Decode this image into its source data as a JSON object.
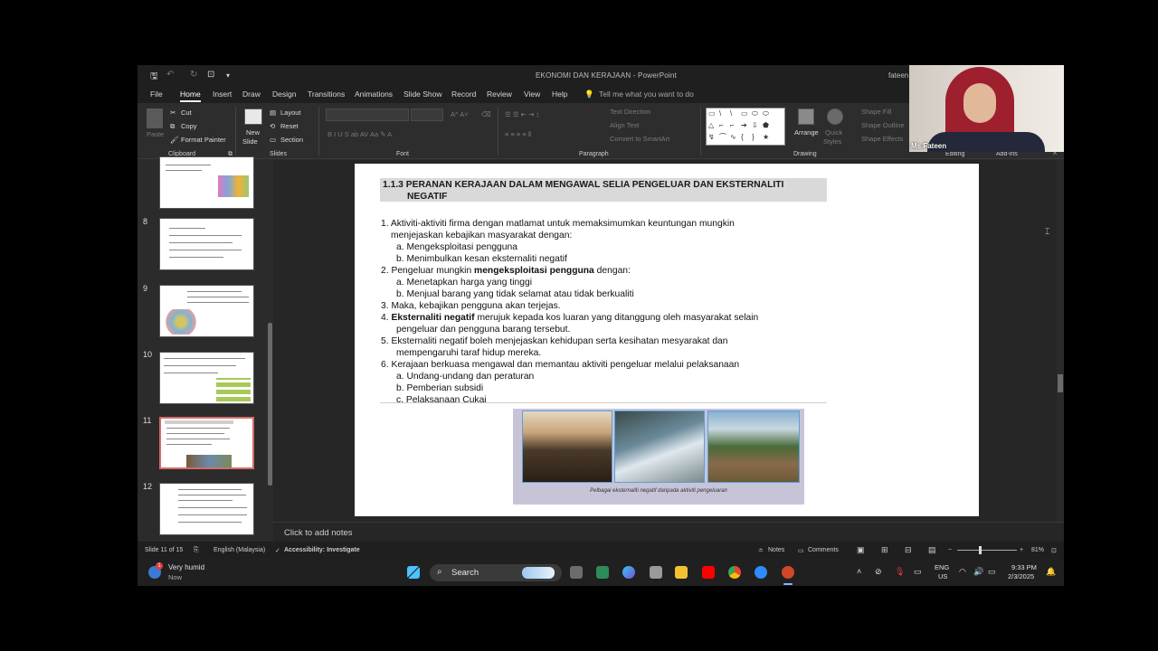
{
  "titlebar": {
    "title": "EKONOMI DAN KERAJAAN  -  PowerPoint",
    "user": "fateen"
  },
  "tabs": [
    "File",
    "Home",
    "Insert",
    "Draw",
    "Design",
    "Transitions",
    "Animations",
    "Slide Show",
    "Record",
    "Review",
    "View",
    "Help"
  ],
  "tell_me": "Tell me what you want to do",
  "ribbon": {
    "clipboard": {
      "label": "Clipboard",
      "paste": "Paste",
      "cut": "Cut",
      "copy": "Copy",
      "format_painter": "Format Painter"
    },
    "slides": {
      "label": "Slides",
      "new_slide": "New",
      "new_slide2": "Slide",
      "layout": "Layout",
      "reset": "Reset",
      "section": "Section"
    },
    "font": {
      "label": "Font"
    },
    "paragraph": {
      "label": "Paragraph",
      "text_direction": "Text Direction",
      "align_text": "Align Text",
      "convert_smartart": "Convert to SmartArt"
    },
    "drawing": {
      "label": "Drawing",
      "arrange": "Arrange",
      "quick_styles": "Quick",
      "quick_styles2": "Styles",
      "shape_fill": "Shape Fill",
      "shape_outline": "Shape Outline",
      "shape_effects": "Shape Effects"
    },
    "editing": {
      "label": "Editing"
    },
    "addins": {
      "label": "Add-ins"
    }
  },
  "thumbnails": [
    {
      "num": ""
    },
    {
      "num": "8"
    },
    {
      "num": "9"
    },
    {
      "num": "10"
    },
    {
      "num": "11",
      "selected": true
    },
    {
      "num": "12"
    }
  ],
  "slide": {
    "title_line1": "1.1.3 PERANAN KERAJAAN DALAM MENGAWAL SELIA PENGELUAR DAN EKSTERNALITI",
    "title_line2": "NEGATIF",
    "l1a": "1.  Aktiviti-aktiviti firma dengan matlamat untuk memaksimumkan keuntungan mungkin",
    "l1b": "menjejaskan kebajikan masyarakat dengan:",
    "l1_items": [
      "a.   Mengeksploitasi pengguna",
      "b.   Menimbulkan kesan eksternaliti negatif"
    ],
    "l2_pre": "2.  Pengeluar mungkin ",
    "l2_bold": "mengeksploitasi pengguna",
    "l2_post": " dengan:",
    "l2_items": [
      "a.   Menetapkan harga yang tinggi",
      "b.   Menjual barang yang tidak selamat atau tidak berkualiti"
    ],
    "l3": "3.  Maka, kebajikan pengguna akan terjejas.",
    "l4_pre": "4.  ",
    "l4_bold": "Eksternaliti negatif",
    "l4_post": "  merujuk kepada kos luaran yang ditanggung oleh masyarakat selain",
    "l4b": "pengeluar dan pengguna barang tersebut.",
    "l5a": "5.   Eksternaliti negatif boleh menjejaskan kehidupan serta kesihatan mesyarakat dan",
    "l5b": "mempengaruhi taraf hidup mereka.",
    "l6": "6.   Kerajaan berkuasa mengawal dan memantau aktiviti pengeluar melalui pelaksanaan",
    "l6_items": [
      "a.   Undang-undang dan peraturan",
      "b.   Pemberian subsidi",
      "c.   Pelaksanaan Cukai"
    ],
    "caption": "Pelbagai eksternaliti negatif daripada aktiviti pengeluaran"
  },
  "notes_placeholder": "Click to add notes",
  "status": {
    "slide_of": "Slide 11 of 15",
    "language": "English (Malaysia)",
    "accessibility": "Accessibility: Investigate",
    "notes": "Notes",
    "comments": "Comments",
    "zoom": "81%"
  },
  "taskbar": {
    "weather": "Very humid",
    "weather_sub": "Now",
    "search": "Search",
    "lang1": "ENG",
    "lang2": "US",
    "time": "9:33 PM",
    "date": "2/3/2025"
  },
  "webcam": {
    "name": "Ms.Fateen"
  }
}
